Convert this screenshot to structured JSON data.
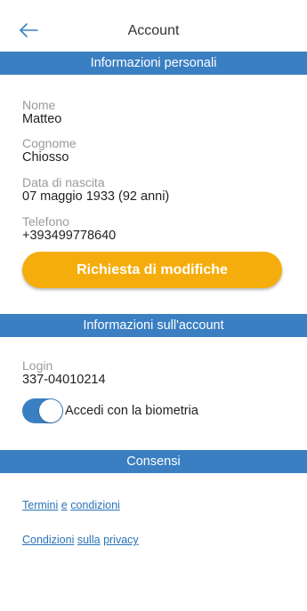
{
  "header": {
    "title": "Account",
    "back_icon": "arrow-left-icon",
    "accent_color": "#3a7fc2"
  },
  "personal": {
    "section_title": "Informazioni personali",
    "fields": [
      {
        "label": "Nome",
        "value": "Matteo"
      },
      {
        "label": "Cognome",
        "value": "Chiosso"
      },
      {
        "label": "Data di nascita",
        "value": "07 maggio 1933 (92 anni)"
      },
      {
        "label": "Telefono",
        "value": "+393499778640"
      }
    ],
    "request_changes_label": "Richiesta di modifiche",
    "button_color": "#f5ad0d"
  },
  "account": {
    "section_title": "Informazioni sull'account",
    "login_label": "Login",
    "login_value": "337-04010214",
    "biometrics_label": "Accedi con la biometria",
    "biometrics_enabled": true
  },
  "consents": {
    "section_title": "Consensi",
    "terms_links": [
      "Termini",
      "e",
      "condizioni"
    ],
    "privacy_links": [
      "Condizioni",
      "sulla",
      "privacy"
    ]
  }
}
